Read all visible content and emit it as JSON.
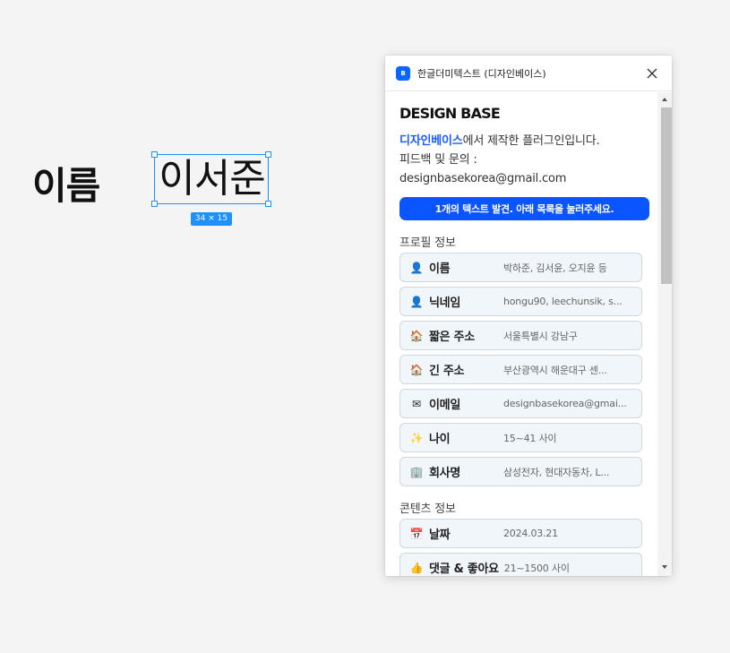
{
  "canvas": {
    "label": "이름",
    "selected_text": "이서준",
    "size_badge": "34 × 15"
  },
  "plugin": {
    "title": "한글더미텍스트 (디자인베이스)",
    "app_icon_letter": "B",
    "logo": "DESIGN BASE",
    "description_brand": "디자인베이스",
    "description_rest": "에서 제작한 플러그인입니다.",
    "feedback_label": "피드백 및 문의 :",
    "email": "designbasekorea@gmail.com",
    "cta": "1개의 텍스트 발견. 아래 목록을 눌러주세요.",
    "sections": [
      {
        "title": "프로필 정보",
        "items": [
          {
            "icon": "person-icon",
            "glyph": "👤",
            "label": "이름",
            "value": "박하준, 김서윤, 오지윤 등"
          },
          {
            "icon": "nickname-icon",
            "glyph": "👤",
            "label": "닉네임",
            "value": "hongu90, leechunsik, s..."
          },
          {
            "icon": "house-icon",
            "glyph": "🏠",
            "label": "짧은 주소",
            "value": "서울특별시 강남구"
          },
          {
            "icon": "house-icon",
            "glyph": "🏠",
            "label": "긴 주소",
            "value": "부산광역시 해운대구 센..."
          },
          {
            "icon": "envelope-icon",
            "glyph": "✉",
            "label": "이메일",
            "value": "designbasekorea@gmai..."
          },
          {
            "icon": "sparkle-icon",
            "glyph": "✨",
            "label": "나이",
            "value": "15~41 사이"
          },
          {
            "icon": "building-icon",
            "glyph": "🏢",
            "label": "회사명",
            "value": "삼성전자, 현대자동차, L..."
          }
        ]
      },
      {
        "title": "콘텐츠 정보",
        "items": [
          {
            "icon": "calendar-icon",
            "glyph": "📅",
            "label": "날짜",
            "value": "2024.03.21"
          },
          {
            "icon": "thumbs-up-icon",
            "glyph": "👍",
            "label": "댓글 & 좋아요",
            "value": "21~1500 사이"
          }
        ]
      }
    ]
  },
  "colors": {
    "accent": "#0b55ff",
    "selection": "#1e90ff",
    "row_bg": "#f1f6fa"
  }
}
